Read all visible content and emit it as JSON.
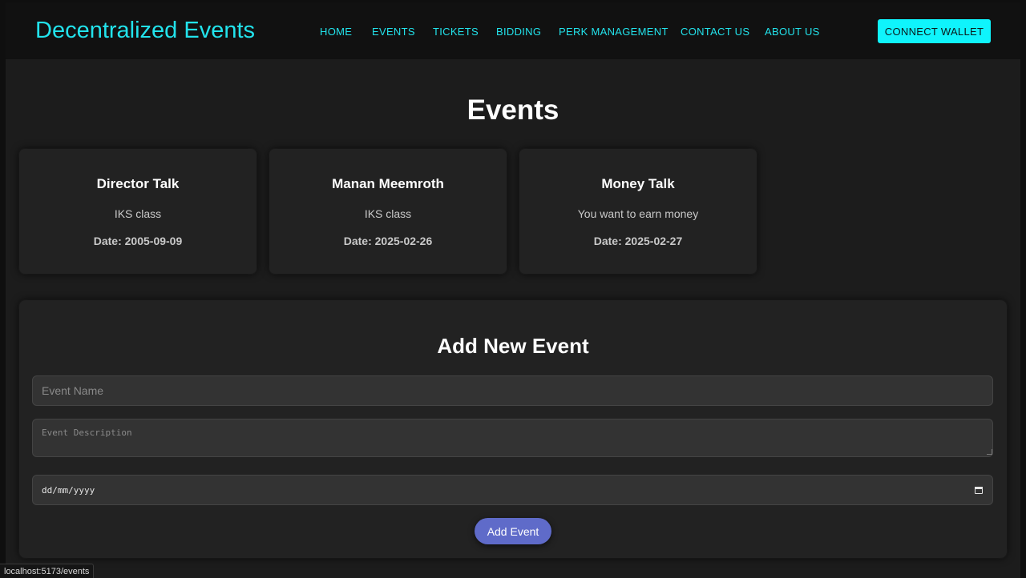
{
  "navbar": {
    "brand": "Decentralized Events",
    "links": [
      {
        "label": "HOME"
      },
      {
        "label": "EVENTS"
      },
      {
        "label": "TICKETS"
      },
      {
        "label": "BIDDING"
      },
      {
        "label": "PERK MANAGEMENT"
      },
      {
        "label": "CONTACT US"
      },
      {
        "label": "ABOUT US"
      }
    ],
    "connect_label": "CONNECT WALLET"
  },
  "page": {
    "title": "Events"
  },
  "events": [
    {
      "name": "Director Talk",
      "description": "IKS class",
      "date": "Date: 2005-09-09"
    },
    {
      "name": "Manan Meemroth",
      "description": "IKS class",
      "date": "Date: 2025-02-26"
    },
    {
      "name": "Money Talk",
      "description": "You want to earn money",
      "date": "Date: 2025-02-27"
    }
  ],
  "form": {
    "title": "Add New Event",
    "name_placeholder": "Event Name",
    "description_placeholder": "Event Description",
    "date_placeholder": "dd/mm/yyyy",
    "submit_label": "Add Event"
  },
  "status_bar": {
    "url": "localhost:5173/events"
  },
  "colors": {
    "accent": "#22e3ec",
    "connect_button": "#0ff4fc",
    "submit_button": "#5f6bc9",
    "background": "#1c1c1c",
    "card": "#222222"
  },
  "icons": {
    "date_picker": "calendar-icon"
  }
}
